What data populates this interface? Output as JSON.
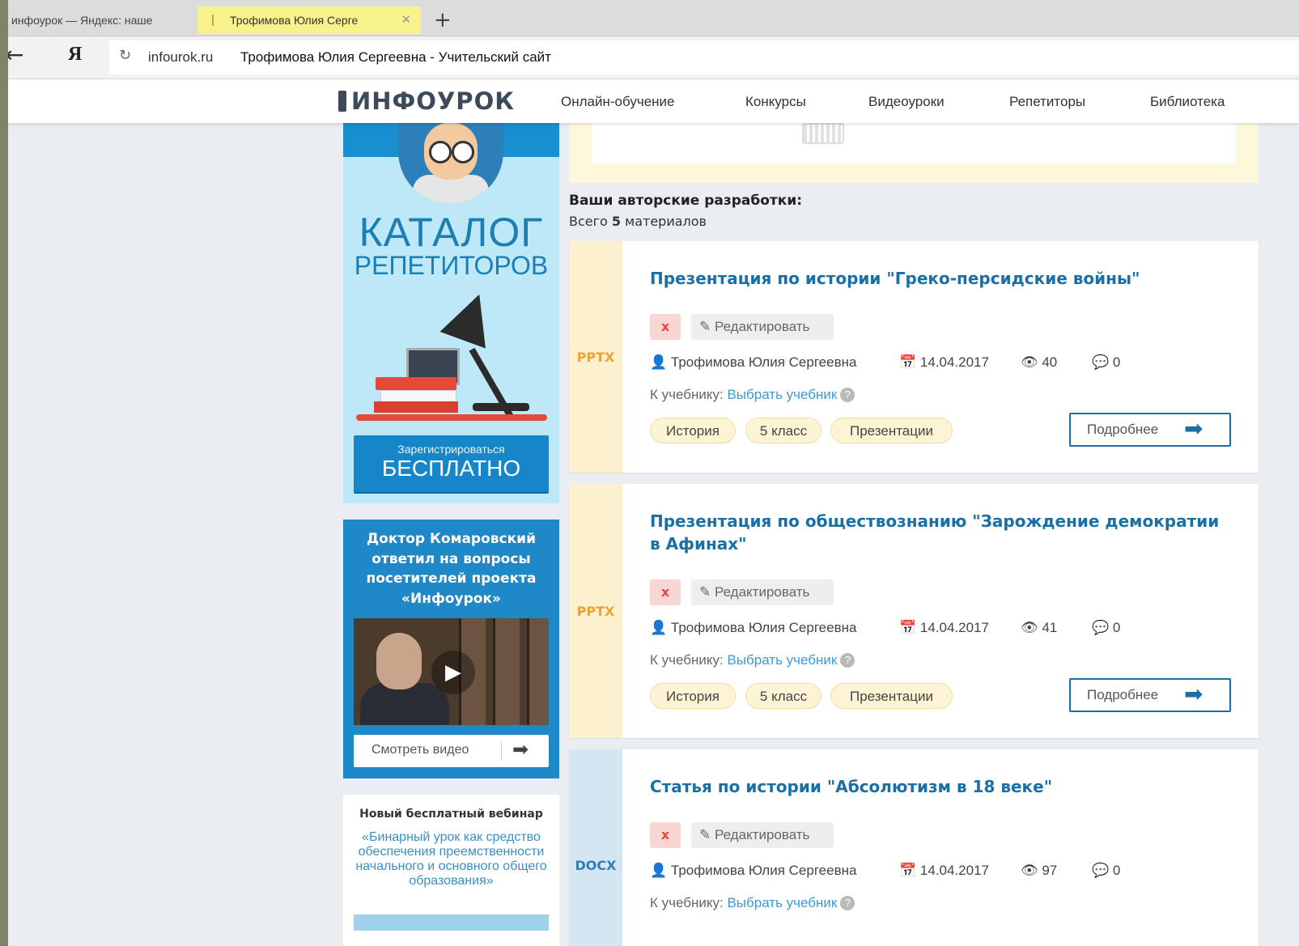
{
  "browser": {
    "tabs": [
      {
        "label": "инфоурок — Яндекс: наше"
      },
      {
        "label": "Трофимова Юлия Серге"
      }
    ],
    "new_tab": "+",
    "address": {
      "domain": "infourok.ru",
      "title": "Трофимова Юлия Сергеевна - Учительский сайт"
    }
  },
  "header": {
    "logo": "ИНФОУРОК",
    "nav": [
      "Онлайн-обучение",
      "Конкурсы",
      "Видеоуроки",
      "Репетиторы",
      "Библиотека"
    ]
  },
  "sidebar": {
    "catalog": {
      "title": "КАТАЛОГ",
      "subtitle": "РЕПЕТИТОРОВ",
      "register_small": "Зарегистрироваться",
      "register_big": "БЕСПЛАТНО"
    },
    "video_promo": {
      "text": "Доктор Комаровский ответил на вопросы посетителей проекта «Инфоурок»",
      "watch_label": "Смотреть видео"
    },
    "webinar": {
      "title": "Новый бесплатный вебинар",
      "text": "«Бинарный урок как средство обеспечения преемственности начального и основного общего образования»"
    }
  },
  "main": {
    "works_title": "Ваши авторские разработки:",
    "count_prefix": "Всего",
    "count_value": "5",
    "count_suffix": "материалов",
    "cards": [
      {
        "file_type": "PPTX",
        "title": "Презентация по истории \"Греко-персидские войны\"",
        "delete_label": "x",
        "edit_label": "Редактировать",
        "author": "Трофимова Юлия Сергеевна",
        "date": "14.04.2017",
        "views": "40",
        "comments": "0",
        "textbook_label": "К учебнику:",
        "textbook_link": "Выбрать учебник",
        "tags": [
          "История",
          "5 класс",
          "Презентации"
        ],
        "more_label": "Подробнее"
      },
      {
        "file_type": "PPTX",
        "title": "Презентация по обществознанию \"Зарождение демократии в Афинах\"",
        "delete_label": "x",
        "edit_label": "Редактировать",
        "author": "Трофимова Юлия Сергеевна",
        "date": "14.04.2017",
        "views": "41",
        "comments": "0",
        "textbook_label": "К учебнику:",
        "textbook_link": "Выбрать учебник",
        "tags": [
          "История",
          "5 класс",
          "Презентации"
        ],
        "more_label": "Подробнее"
      },
      {
        "file_type": "DOCX",
        "title": "Статья по истории \"Абсолютизм в 18 веке\"",
        "delete_label": "x",
        "edit_label": "Редактировать",
        "author": "Трофимова Юлия Сергеевна",
        "date": "14.04.2017",
        "views": "97",
        "comments": "0",
        "textbook_label": "К учебнику:",
        "textbook_link": "Выбрать учебник"
      }
    ]
  },
  "colors": {
    "pptx_strip": "#fdf0cf",
    "pptx_text": "#e8a33a",
    "docx_strip": "#d3e6f2",
    "docx_text": "#2f7fb5",
    "accent": "#1a6fa5"
  }
}
